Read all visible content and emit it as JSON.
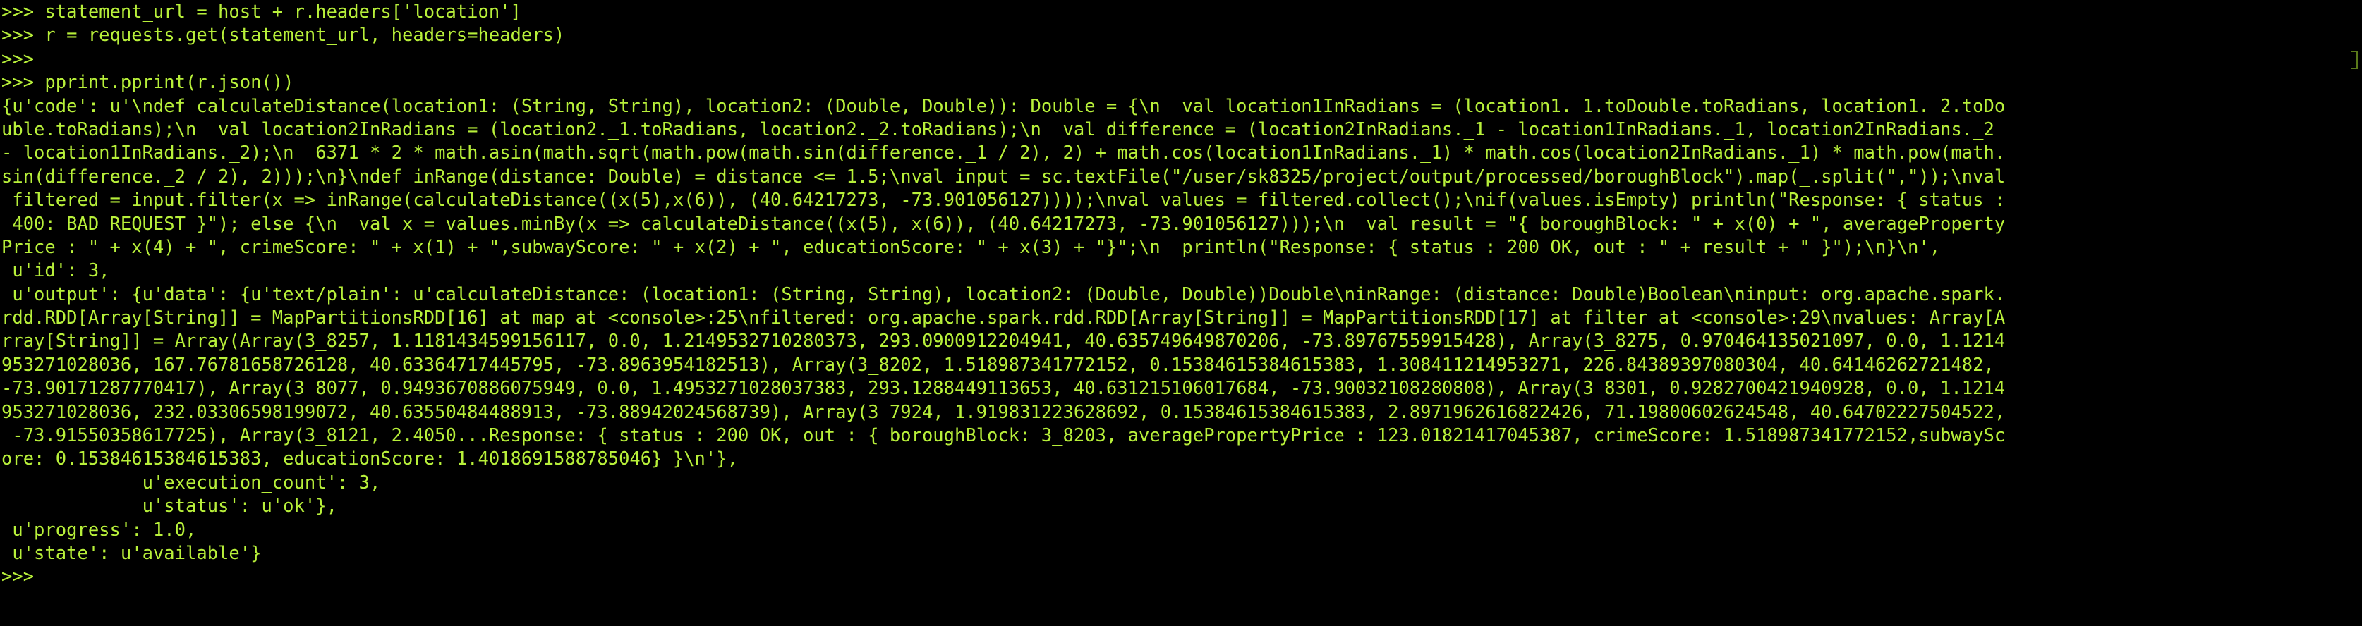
{
  "terminal": {
    "text_color": "#b8f03a",
    "background_color": "#000000",
    "lines": [
      ">>> statement_url = host + r.headers['location']",
      ">>> r = requests.get(statement_url, headers=headers)",
      ">>>",
      ">>> pprint.pprint(r.json())",
      "{u'code': u'\\ndef calculateDistance(location1: (String, String), location2: (Double, Double)): Double = {\\n  val location1InRadians = (location1._1.toDouble.toRadians, location1._2.toDo",
      "uble.toRadians);\\n  val location2InRadians = (location2._1.toRadians, location2._2.toRadians);\\n  val difference = (location2InRadians._1 - location1InRadians._1, location2InRadians._2",
      "- location1InRadians._2);\\n  6371 * 2 * math.asin(math.sqrt(math.pow(math.sin(difference._1 / 2), 2) + math.cos(location1InRadians._1) * math.cos(location2InRadians._1) * math.pow(math.",
      "sin(difference._2 / 2), 2)));\\n}\\ndef inRange(distance: Double) = distance <= 1.5;\\nval input = sc.textFile(\"/user/sk8325/project/output/processed/boroughBlock\").map(_.split(\",\"));\\nval",
      " filtered = input.filter(x => inRange(calculateDistance((x(5),x(6)), (40.64217273, -73.901056127))));\\nval values = filtered.collect();\\nif(values.isEmpty) println(\"Response: { status :",
      " 400: BAD REQUEST }\"); else {\\n  val x = values.minBy(x => calculateDistance((x(5), x(6)), (40.64217273, -73.901056127)));\\n  val result = \"{ boroughBlock: \" + x(0) + \", averageProperty",
      "Price : \" + x(4) + \", crimeScore: \" + x(1) + \",subwayScore: \" + x(2) + \", educationScore: \" + x(3) + \"}\";\\n  println(\"Response: { status : 200 OK, out : \" + result + \" }\");\\n}\\n',",
      " u'id': 3,",
      " u'output': {u'data': {u'text/plain': u'calculateDistance: (location1: (String, String), location2: (Double, Double))Double\\ninRange: (distance: Double)Boolean\\ninput: org.apache.spark.",
      "rdd.RDD[Array[String]] = MapPartitionsRDD[16] at map at <console>:25\\nfiltered: org.apache.spark.rdd.RDD[Array[String]] = MapPartitionsRDD[17] at filter at <console>:29\\nvalues: Array[A",
      "rray[String]] = Array(Array(3_8257, 1.1181434599156117, 0.0, 1.2149532710280373, 293.0900912204941, 40.635749649870206, -73.89767559915428), Array(3_8275, 0.970464135021097, 0.0, 1.1214",
      "953271028036, 167.76781658726128, 40.63364717445795, -73.8963954182513), Array(3_8202, 1.518987341772152, 0.15384615384615383, 1.308411214953271, 226.84389397080304, 40.64146262721482,",
      "-73.90171287770417), Array(3_8077, 0.9493670886075949, 0.0, 1.4953271028037383, 293.1288449113653, 40.631215106017684, -73.90032108280808), Array(3_8301, 0.9282700421940928, 0.0, 1.1214",
      "953271028036, 232.03306598199072, 40.63550484488913, -73.88942024568739), Array(3_7924, 1.919831223628692, 0.15384615384615383, 2.8971962616822426, 71.19800602624548, 40.64702227504522,",
      " -73.91550358617725), Array(3_8121, 2.4050...Response: { status : 200 OK, out : { boroughBlock: 3_8203, averagePropertyPrice : 123.01821417045387, crimeScore: 1.518987341772152,subwaySc",
      "ore: 0.15384615384615383, educationScore: 1.4018691588785046} }\\n'},",
      "             u'execution_count': 3,",
      "             u'status': u'ok'},",
      " u'progress': 1.0,",
      " u'state': u'available'}",
      ">>>"
    ]
  }
}
